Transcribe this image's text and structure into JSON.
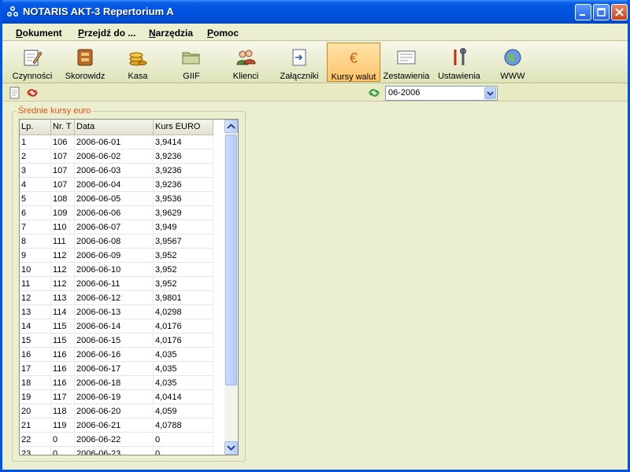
{
  "window": {
    "title": "NOTARIS AKT-3 Repertorium A"
  },
  "menu": [
    {
      "label": "Dokument"
    },
    {
      "label": "Przejdź do ..."
    },
    {
      "label": "Narzędzia"
    },
    {
      "label": "Pomoc"
    }
  ],
  "toolbar": [
    {
      "label": "Czynności",
      "icon": "notebook-pen-icon"
    },
    {
      "label": "Skorowidz",
      "icon": "index-box-icon"
    },
    {
      "label": "Kasa",
      "icon": "coins-icon"
    },
    {
      "label": "GIIF",
      "icon": "folder-icon"
    },
    {
      "label": "Klienci",
      "icon": "people-icon"
    },
    {
      "label": "Załączniki",
      "icon": "attachment-icon"
    },
    {
      "label": "Kursy walut",
      "icon": "euro-icon",
      "active": true
    },
    {
      "label": "Zestawienia",
      "icon": "report-icon"
    },
    {
      "label": "Ustawienia",
      "icon": "tools-icon"
    },
    {
      "label": "WWW",
      "icon": "globe-icon"
    }
  ],
  "subbar": {
    "month": "06-2006"
  },
  "group": {
    "title": "Średnie kursy euro",
    "columns": [
      "Lp.",
      "Nr. T",
      "Data",
      "Kurs EURO"
    ],
    "rows": [
      [
        "1",
        "106",
        "2006-06-01",
        "3,9414"
      ],
      [
        "2",
        "107",
        "2006-06-02",
        "3,9236"
      ],
      [
        "3",
        "107",
        "2006-06-03",
        "3,9236"
      ],
      [
        "4",
        "107",
        "2006-06-04",
        "3,9236"
      ],
      [
        "5",
        "108",
        "2006-06-05",
        "3,9536"
      ],
      [
        "6",
        "109",
        "2006-06-06",
        "3,9629"
      ],
      [
        "7",
        "110",
        "2006-06-07",
        "3,949"
      ],
      [
        "8",
        "111",
        "2006-06-08",
        "3,9567"
      ],
      [
        "9",
        "112",
        "2006-06-09",
        "3,952"
      ],
      [
        "10",
        "112",
        "2006-06-10",
        "3,952"
      ],
      [
        "11",
        "112",
        "2006-06-11",
        "3,952"
      ],
      [
        "12",
        "113",
        "2006-06-12",
        "3,9801"
      ],
      [
        "13",
        "114",
        "2006-06-13",
        "4,0298"
      ],
      [
        "14",
        "115",
        "2006-06-14",
        "4,0176"
      ],
      [
        "15",
        "115",
        "2006-06-15",
        "4,0176"
      ],
      [
        "16",
        "116",
        "2006-06-16",
        "4,035"
      ],
      [
        "17",
        "116",
        "2006-06-17",
        "4,035"
      ],
      [
        "18",
        "116",
        "2006-06-18",
        "4,035"
      ],
      [
        "19",
        "117",
        "2006-06-19",
        "4,0414"
      ],
      [
        "20",
        "118",
        "2006-06-20",
        "4,059"
      ],
      [
        "21",
        "119",
        "2006-06-21",
        "4,0788"
      ],
      [
        "22",
        "0",
        "2006-06-22",
        "0"
      ],
      [
        "23",
        "0",
        "2006-06-23",
        "0"
      ]
    ]
  },
  "colors": {
    "accent": "#0054E3",
    "panel": "#ECEFCF",
    "group_title": "#E0531B",
    "active_tool": "#FFC46A"
  }
}
